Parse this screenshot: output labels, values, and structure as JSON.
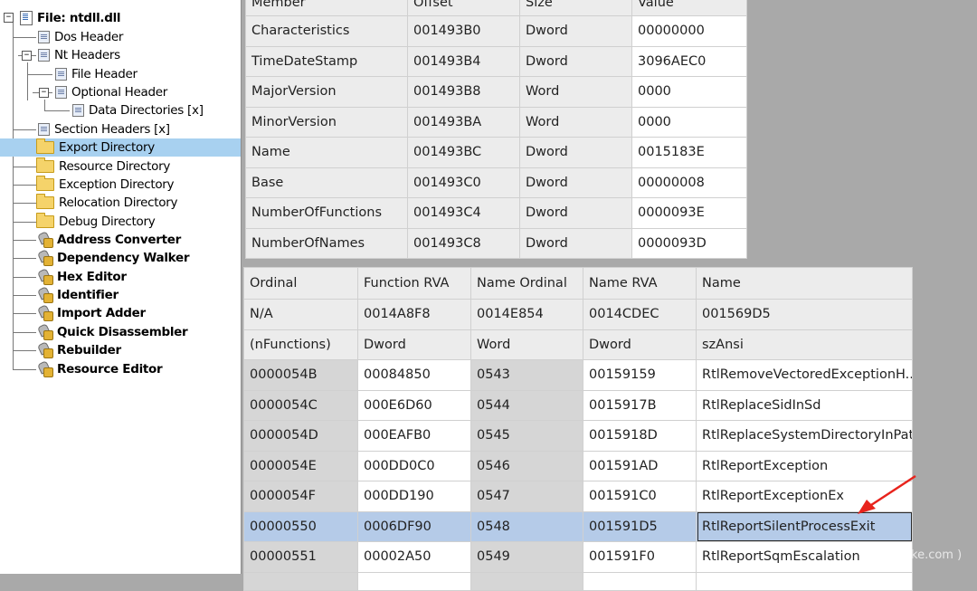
{
  "tree": {
    "root": "File: ntdll.dll",
    "items": [
      {
        "label": "Dos Header",
        "icon": "document-icon"
      },
      {
        "label": "Nt Headers",
        "icon": "document-icon"
      },
      {
        "label": "File Header",
        "icon": "document-icon"
      },
      {
        "label": "Optional Header",
        "icon": "document-icon"
      },
      {
        "label": "Data Directories [x]",
        "icon": "document-icon"
      },
      {
        "label": "Section Headers [x]",
        "icon": "document-icon"
      },
      {
        "label": "Export Directory",
        "icon": "folder-open-icon",
        "selected": true
      },
      {
        "label": "Resource Directory",
        "icon": "folder-icon"
      },
      {
        "label": "Exception Directory",
        "icon": "folder-icon"
      },
      {
        "label": "Relocation Directory",
        "icon": "folder-icon"
      },
      {
        "label": "Debug Directory",
        "icon": "folder-icon"
      },
      {
        "label": "Address Converter",
        "icon": "tool-icon"
      },
      {
        "label": "Dependency Walker",
        "icon": "tool-icon"
      },
      {
        "label": "Hex Editor",
        "icon": "tool-icon"
      },
      {
        "label": "Identifier",
        "icon": "tool-icon"
      },
      {
        "label": "Import Adder",
        "icon": "tool-icon"
      },
      {
        "label": "Quick Disassembler",
        "icon": "tool-icon"
      },
      {
        "label": "Rebuilder",
        "icon": "tool-icon"
      },
      {
        "label": "Resource Editor",
        "icon": "tool-icon"
      }
    ]
  },
  "export_table": {
    "headers": [
      "Member",
      "Offset",
      "Size",
      "Value"
    ],
    "rows": [
      [
        "Characteristics",
        "001493B0",
        "Dword",
        "00000000"
      ],
      [
        "TimeDateStamp",
        "001493B4",
        "Dword",
        "3096AEC0"
      ],
      [
        "MajorVersion",
        "001493B8",
        "Word",
        "0000"
      ],
      [
        "MinorVersion",
        "001493BA",
        "Word",
        "0000"
      ],
      [
        "Name",
        "001493BC",
        "Dword",
        "0015183E"
      ],
      [
        "Base",
        "001493C0",
        "Dword",
        "00000008"
      ],
      [
        "NumberOfFunctions",
        "001493C4",
        "Dword",
        "0000093E"
      ],
      [
        "NumberOfNames",
        "001493C8",
        "Dword",
        "0000093D"
      ]
    ]
  },
  "functions_table": {
    "headers": [
      "Ordinal",
      "Function RVA",
      "Name Ordinal",
      "Name RVA",
      "Name"
    ],
    "info_rows": [
      [
        "N/A",
        "0014A8F8",
        "0014E854",
        "0014CDEC",
        "001569D5"
      ],
      [
        "(nFunctions)",
        "Dword",
        "Word",
        "Dword",
        "szAnsi"
      ]
    ],
    "rows": [
      [
        "0000054B",
        "00084850",
        "0543",
        "00159159",
        "RtlRemoveVectoredExceptionH..."
      ],
      [
        "0000054C",
        "000E6D60",
        "0544",
        "0015917B",
        "RtlReplaceSidInSd"
      ],
      [
        "0000054D",
        "000EAFB0",
        "0545",
        "0015918D",
        "RtlReplaceSystemDirectoryInPath"
      ],
      [
        "0000054E",
        "000DD0C0",
        "0546",
        "001591AD",
        "RtlReportException"
      ],
      [
        "0000054F",
        "000DD190",
        "0547",
        "001591C0",
        "RtlReportExceptionEx"
      ],
      [
        "00000550",
        "0006DF90",
        "0548",
        "001591D5",
        "RtlReportSilentProcessExit"
      ],
      [
        "00000551",
        "00002A50",
        "0549",
        "001591F0",
        "RtlReportSqmEscalation"
      ]
    ],
    "selected_row": 5
  },
  "watermark": "ke.com )",
  "colors": {
    "selection": "#b5cbe8",
    "tree_selection": "#a8d1f0",
    "arrow": "#e8231c"
  }
}
